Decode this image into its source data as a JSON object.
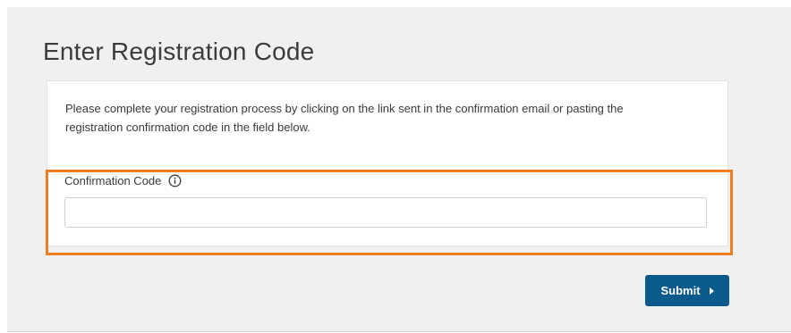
{
  "page": {
    "title": "Enter Registration Code"
  },
  "card": {
    "instructions": "Please complete your registration process by clicking on the link sent in the confirmation email or pasting the registration confirmation code in the field below."
  },
  "form": {
    "confirmation_label": "Confirmation Code",
    "confirmation_value": "",
    "confirmation_placeholder": "",
    "info_icon": "info-circle-icon"
  },
  "actions": {
    "submit_label": "Submit",
    "submit_icon": "caret-right-icon"
  },
  "colors": {
    "panel_background": "#f0f0f0",
    "primary_button": "#0b5a8c",
    "highlight": "#ef7d22"
  }
}
